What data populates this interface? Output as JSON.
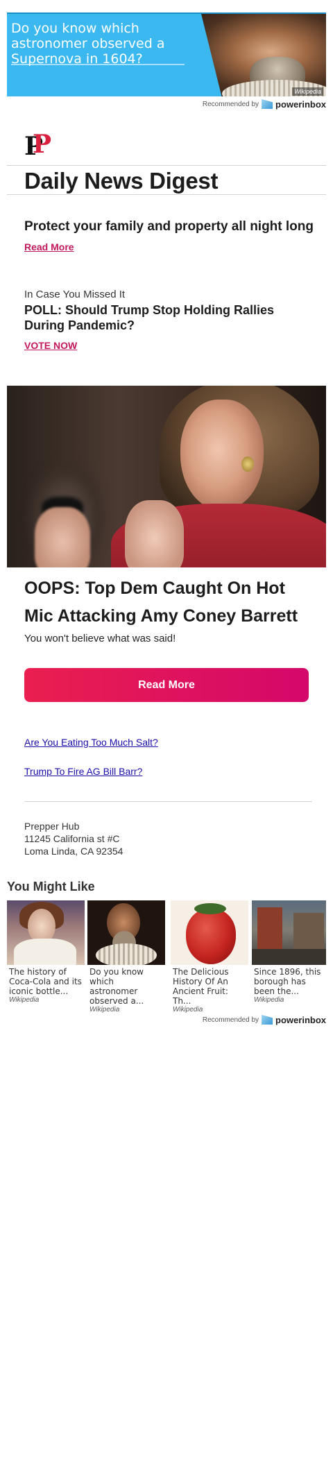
{
  "top_ad": {
    "text": "Do you know which astronomer observed a Supernova in 1604?",
    "image_source": "Wikipedia",
    "accent_color": "#3cb8f0"
  },
  "recommended": {
    "label": "Recommended by",
    "brand": "powerinbox"
  },
  "newsletter": {
    "logo_letters": "PP",
    "title": "Daily News Digest",
    "headline_1": "Protect your family and property all night long",
    "read_more_1": "Read More",
    "icymi_label": "In Case You Missed It",
    "poll_text": "POLL: Should Trump Stop Holding Rallies During Pandemic?",
    "vote_now": "VOTE NOW",
    "main_headline": "OOPS: Top Dem Caught On Hot Mic Attacking Amy Coney Barrett",
    "main_subline": "You won't believe what was said!",
    "cta_label": "Read More",
    "link_1": "Are You Eating Too Much Salt?",
    "link_2": "Trump To Fire AG Bill Barr?",
    "address": {
      "name": "Prepper Hub",
      "street": "11245 California st #C",
      "city": "Loma Linda, CA 92354"
    }
  },
  "you_might_like": {
    "heading": "You Might Like",
    "cards": [
      {
        "title": "The history of Coca-Cola and its iconic bottle...",
        "source": "Wikipedia"
      },
      {
        "title": "Do you know which astronomer observed a...",
        "source": "Wikipedia"
      },
      {
        "title": "The Delicious History Of An Ancient Fruit: Th...",
        "source": "Wikipedia"
      },
      {
        "title": "Since 1896, this borough has been the...",
        "source": "Wikipedia"
      }
    ]
  },
  "colors": {
    "brand_red": "#d9203e",
    "link_pink": "#c2185b",
    "cta_gradient_start": "#ea1f4f",
    "cta_gradient_end": "#d4086a",
    "link_blue": "#1a0dab"
  }
}
